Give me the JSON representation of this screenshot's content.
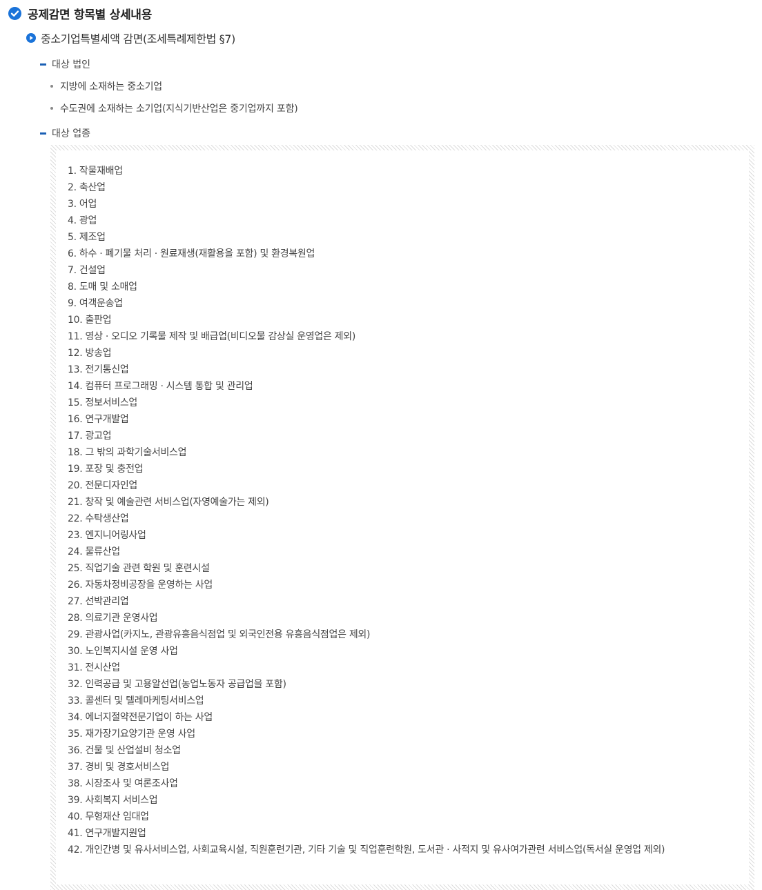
{
  "heading": {
    "title": "공제감면 항목별 상세내용",
    "icon": "check-circle-icon",
    "icon_color": "#1a73d9"
  },
  "subheading": {
    "title": "중소기업특별세액 감면(조세특례제한법 §7)",
    "icon": "play-circle-icon"
  },
  "target_corporations": {
    "label": "대상 법인",
    "items": [
      "지방에 소재하는 중소기업",
      "수도권에 소재하는 소기업(지식기반산업은 중기업까지 포함)"
    ]
  },
  "target_industries": {
    "label": "대상 업종",
    "items": [
      "1. 작물재배업",
      "2. 축산업",
      "3. 어업",
      "4. 광업",
      "5. 제조업",
      "6. 하수 · 폐기물 처리 · 원료재생(재활용을 포함) 및 환경복원업",
      "7. 건설업",
      "8. 도매 및 소매업",
      "9. 여객운송업",
      "10. 출판업",
      "11. 영상 · 오디오 기록물 제작 및 배급업(비디오물 감상실 운영업은 제외)",
      "12. 방송업",
      "13. 전기통신업",
      "14. 컴퓨터 프로그래밍 · 시스템 통합 및 관리업",
      "15. 정보서비스업",
      "16. 연구개발업",
      "17. 광고업",
      "18. 그 밖의 과학기술서비스업",
      "19. 포장 및 충전업",
      "20. 전문디자인업",
      "21. 창작 및 예술관련 서비스업(자영예술가는 제외)",
      "22. 수탁생산업",
      "23. 엔지니어링사업",
      "24. 물류산업",
      "25. 직업기술 관련 학원 및 훈련시설",
      "26. 자동차정비공장을 운영하는 사업",
      "27. 선박관리업",
      "28. 의료기관 운영사업",
      "29. 관광사업(카지노, 관광유흥음식점업 및 외국인전용 유흥음식점업은 제외)",
      "30. 노인복지시설 운영 사업",
      "31. 전시산업",
      "32. 인력공급 및 고용알선업(농업노동자 공급업을 포함)",
      "33. 콜센터 및 텔레마케팅서비스업",
      "34. 에너지절약전문기업이 하는 사업",
      "35. 재가장기요양기관 운영 사업",
      "36. 건물 및 산업설비 청소업",
      "37. 경비 및 경호서비스업",
      "38. 시장조사 및 여론조사업",
      "39. 사회복지 서비스업",
      "40. 무형재산 임대업",
      "41. 연구개발지원업",
      "42. 개인간병 및 유사서비스업, 사회교육시설, 직원훈련기관, 기타 기술 및 직업훈련학원, 도서관 · 사적지 및 유사여가관련 서비스업(독서실 운영업 제외)"
    ]
  }
}
